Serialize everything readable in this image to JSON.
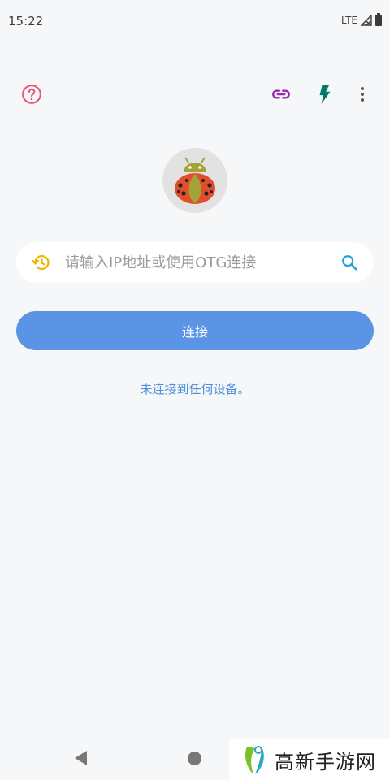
{
  "status_bar": {
    "time": "15:22",
    "network": "LTE"
  },
  "toolbar": {
    "help_icon": "help-circle-icon",
    "link_icon": "link-icon",
    "flash_icon": "flash-icon",
    "more_icon": "more-vertical-icon"
  },
  "colors": {
    "help": "#e85a7a",
    "link": "#9c27b0",
    "flash": "#00796b",
    "history": "#f0b400",
    "search": "#1aa3d9",
    "connect_button": "#5b94e5",
    "status_text": "#4a8fd8"
  },
  "search": {
    "placeholder": "请输入IP地址或使用OTG连接",
    "value": ""
  },
  "connect_button": {
    "label": "连接"
  },
  "connection_status": "未连接到任何设备。",
  "watermark": {
    "text": "高新手游网"
  }
}
